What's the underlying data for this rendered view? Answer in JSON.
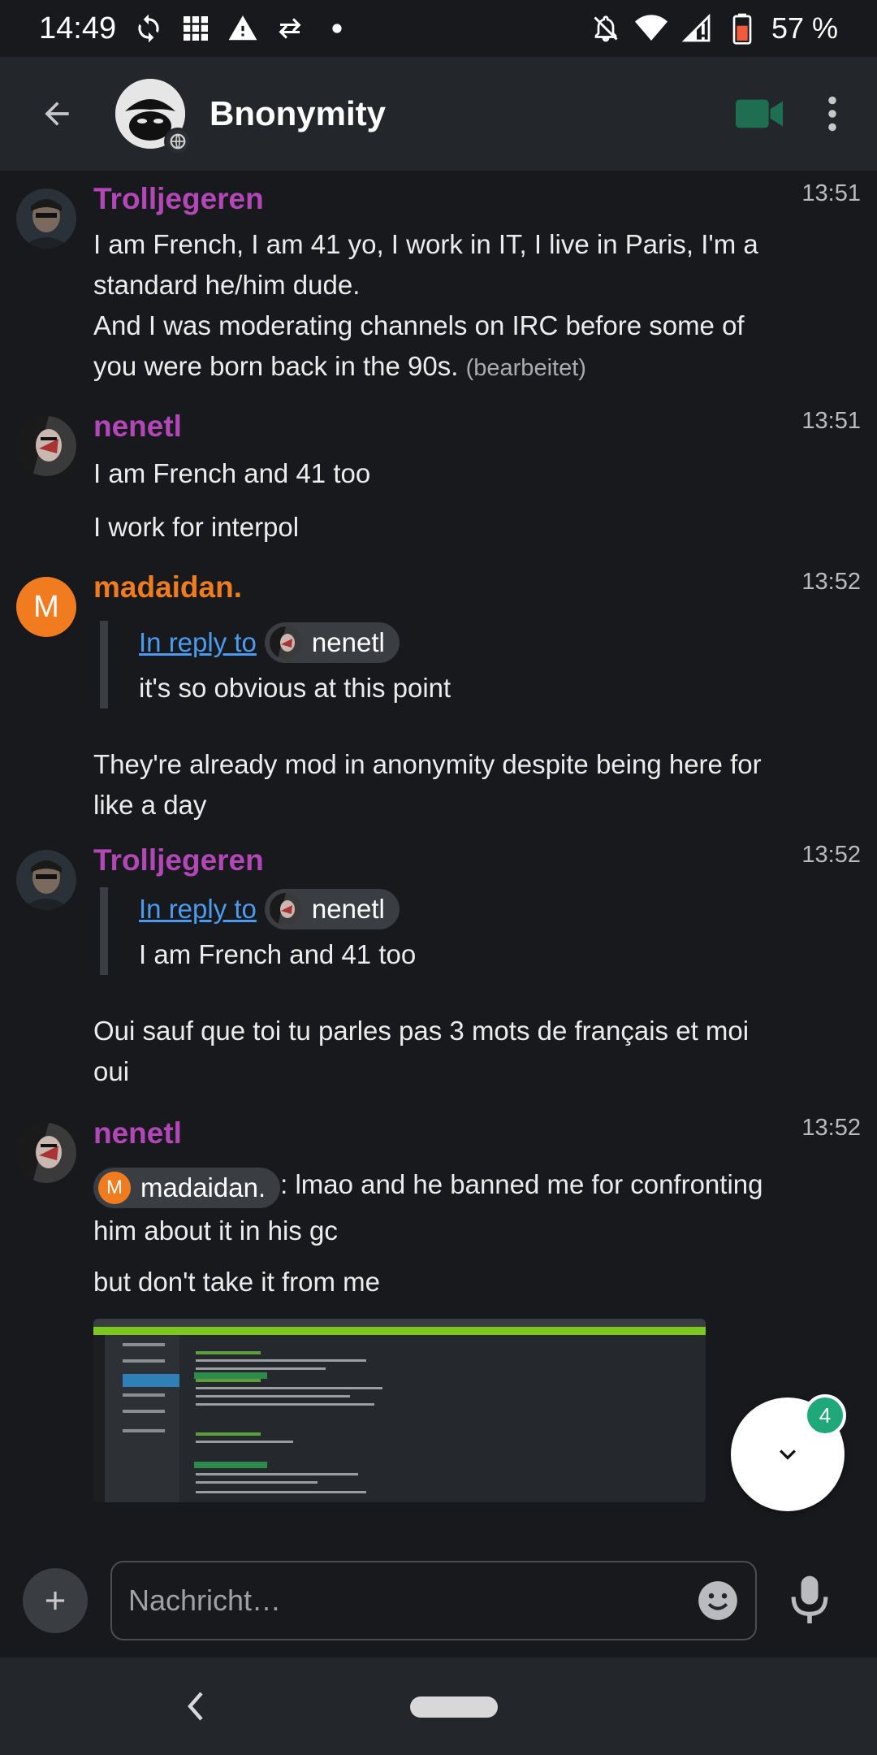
{
  "status_bar": {
    "time": "14:49",
    "battery": "57 %",
    "icons_left": [
      "sync-icon",
      "grid-icon",
      "warning-icon",
      "data-transfer-icon",
      "dot-icon"
    ],
    "icons_right": [
      "mute-icon",
      "wifi-icon",
      "signal-icon",
      "battery-icon"
    ]
  },
  "header": {
    "room_name": "Bnonymity"
  },
  "colors": {
    "accent_green": "#1fa87a",
    "sender_purple": "#b447b8",
    "sender_orange": "#f07c1f",
    "link_blue": "#4b9cf0"
  },
  "messages": [
    {
      "sender": "Trolljegeren",
      "time": "13:51",
      "lines": [
        "I am French, I am 41 yo, I work in IT, I live in Paris, I'm a standard he/him dude.",
        "And I was moderating channels on IRC before some of you were born back in the 90s."
      ],
      "edited": "(bearbeitet)"
    },
    {
      "sender": "nenetl",
      "time": "13:51",
      "lines": [
        "I am French and 41 too",
        "I work for interpol"
      ]
    },
    {
      "sender": "madaidan.",
      "avatar_letter": "M",
      "time": "13:52",
      "reply_link": "In reply to",
      "reply_to": "nenetl",
      "reply_text": "it's so obvious at this point",
      "body": "They're already mod in anonymity despite being here for like a day"
    },
    {
      "sender": "Trolljegeren",
      "time": "13:52",
      "reply_link": "In reply to",
      "reply_to": "nenetl",
      "reply_text": "I am French and 41 too",
      "body": "Oui sauf que toi tu parles pas 3 mots de français et moi oui"
    },
    {
      "sender": "nenetl",
      "time": "13:52",
      "mention": "madaidan.",
      "mention_letter": "M",
      "body_after_mention": ": lmao and he banned me for confronting him about it in his gc",
      "second_line": "but don't take it from me"
    }
  ],
  "scroll_button": {
    "unread_count": "4"
  },
  "composer": {
    "placeholder": "Nachricht…"
  }
}
